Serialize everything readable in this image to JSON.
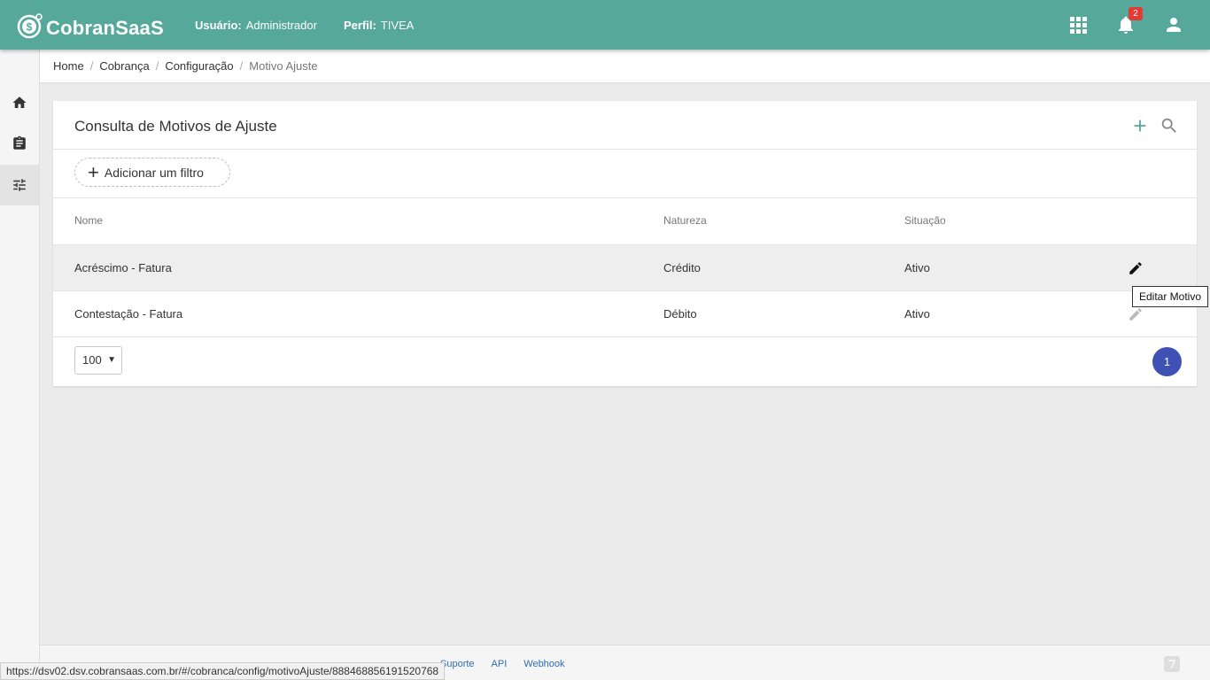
{
  "app": {
    "logo_text": "CobranSaaS",
    "user_label": "Usuário:",
    "user_value": "Administrador",
    "profile_label": "Perfil:",
    "profile_value": "TIVEA",
    "notification_count": "2",
    "brand_color": "#55a89a"
  },
  "sidebar": {
    "items": [
      {
        "icon": "home-icon"
      },
      {
        "icon": "clipboard-icon"
      },
      {
        "icon": "sliders-icon",
        "active": true
      }
    ]
  },
  "breadcrumb": {
    "items": [
      "Home",
      "Cobrança",
      "Configuração"
    ],
    "current": "Motivo Ajuste",
    "separator": "/"
  },
  "card": {
    "title": "Consulta de Motivos de Ajuste",
    "filter_label": "Adicionar um filtro",
    "filter_plus": "+",
    "columns": [
      "Nome",
      "Natureza",
      "Situação"
    ],
    "rows": [
      {
        "nome": "Acréscimo - Fatura",
        "natureza": "Crédito",
        "situacao": "Ativo"
      },
      {
        "nome": "Contestação - Fatura",
        "natureza": "Débito",
        "situacao": "Ativo"
      }
    ],
    "page_size": "100",
    "page_size_caret": "▼",
    "current_page": "1"
  },
  "tooltip": "Editar Motivo",
  "footer": {
    "links": [
      "Suporte",
      "API",
      "Webhook"
    ]
  },
  "status_url": "https://dsv02.dsv.cobransaas.com.br/#/cobranca/config/motivoAjuste/888468856191520768"
}
